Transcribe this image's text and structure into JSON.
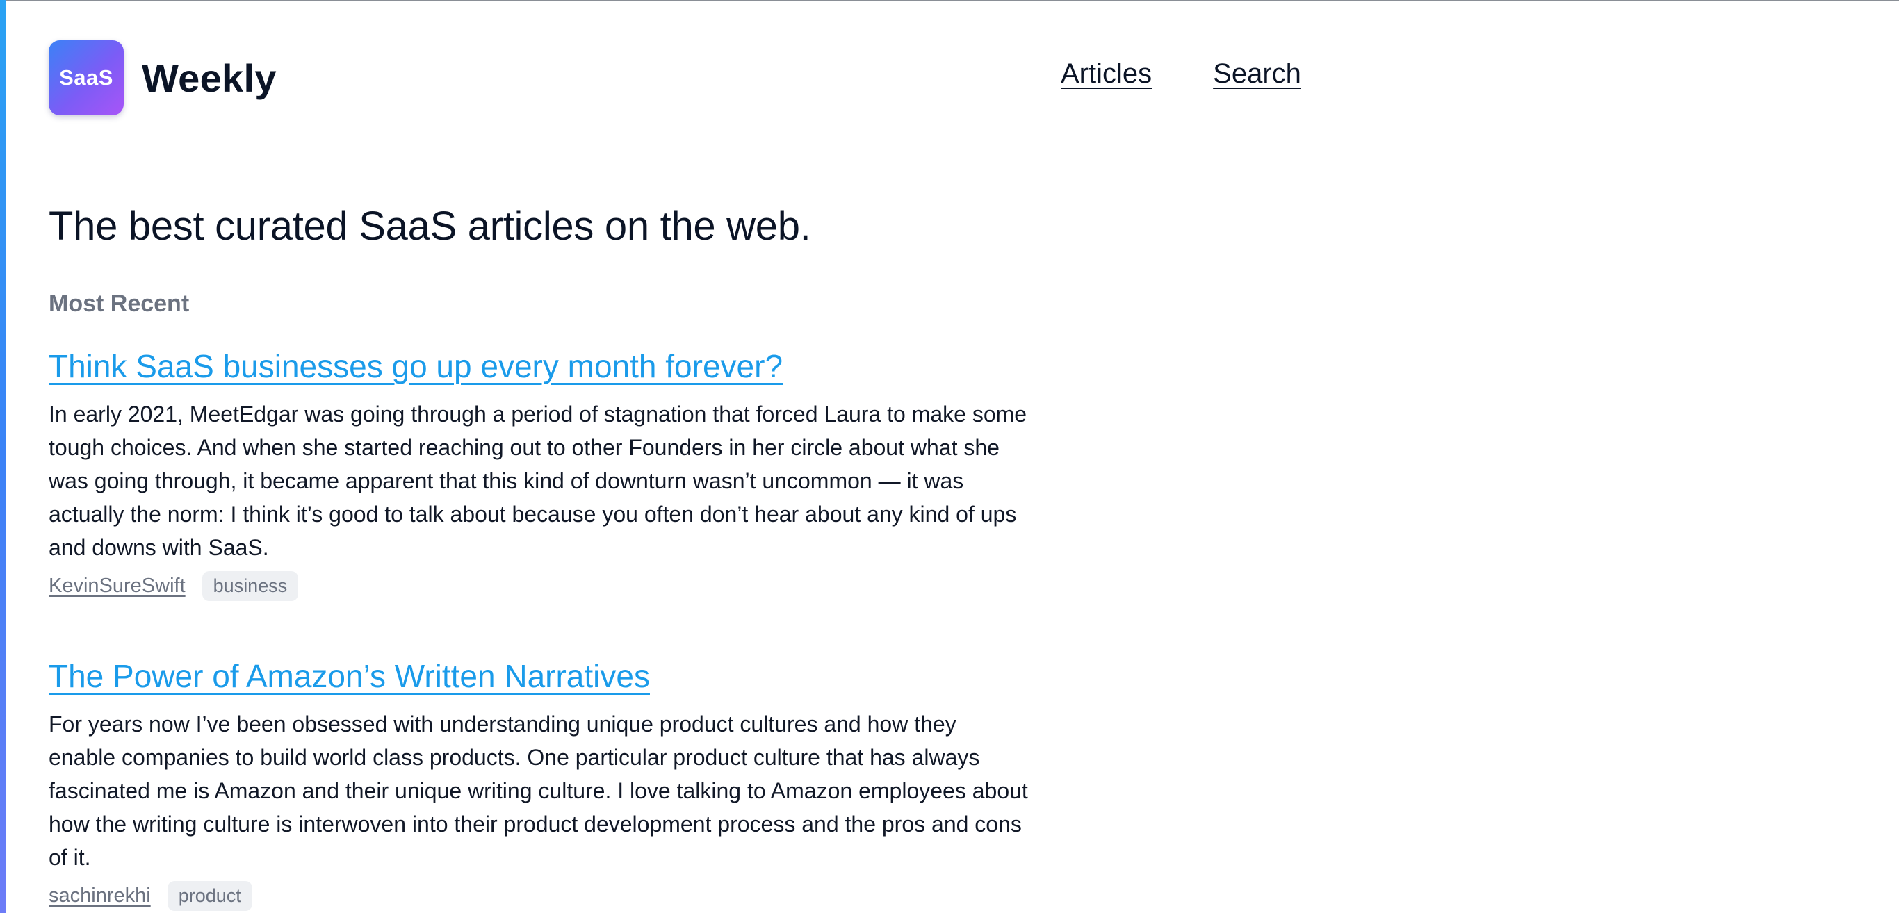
{
  "brand": {
    "logo_text": "SaaS",
    "name": "Weekly"
  },
  "nav": {
    "articles": "Articles",
    "search": "Search"
  },
  "hero": {
    "heading": "The best curated SaaS articles on the web."
  },
  "section": {
    "label": "Most Recent"
  },
  "articles": [
    {
      "title": "Think SaaS businesses go up every month forever?",
      "body": "In early 2021, MeetEdgar was going through a period of stagnation that forced Laura to make some tough choices. And when she started reaching out to other Founders in her circle about what she was going through, it became apparent that this kind of downturn wasn’t uncommon — it was actually the norm: I think it’s good to talk about because you often don’t hear about any kind of ups and downs with SaaS.",
      "author": "KevinSureSwift",
      "tag": "business"
    },
    {
      "title": "The Power of Amazon’s Written Narratives",
      "body": "For years now I’ve been obsessed with understanding unique product cultures and how they enable companies to build world class products. One particular product culture that has always fascinated me is Amazon and their unique writing culture. I love talking to Amazon employees about how the writing culture is interwoven into their product development process and the pros and cons of it.",
      "author": "sachinrekhi",
      "tag": "product"
    }
  ],
  "colors": {
    "link_blue": "#1a9bea",
    "logo_gradient_start": "#3b82f6",
    "logo_gradient_end": "#a855f7",
    "muted_text": "#6b7280"
  }
}
